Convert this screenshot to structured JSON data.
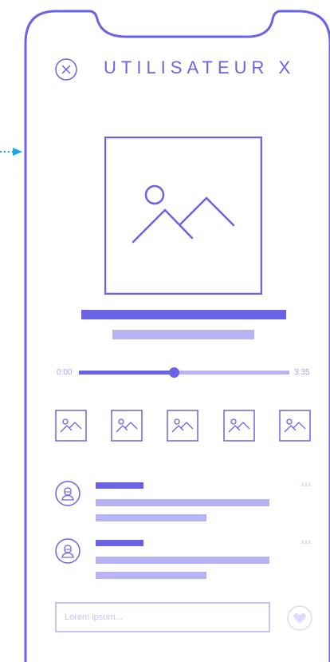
{
  "header": {
    "title": "UTILISATEUR X"
  },
  "player": {
    "time_start": "0:00",
    "time_end": "3:35",
    "progress": 0.45
  },
  "thumbnails": [
    {
      "icon": "image-icon"
    },
    {
      "icon": "image-icon"
    },
    {
      "icon": "image-icon"
    },
    {
      "icon": "image-icon"
    },
    {
      "icon": "image-icon"
    }
  ],
  "comments": [
    {
      "meta": "xxx"
    },
    {
      "meta": "xxx"
    }
  ],
  "composer": {
    "placeholder": "Lorem ipsum..."
  },
  "colors": {
    "primary": "#6a63e6",
    "light": "#b7b3f4",
    "accent": "#18a9e8"
  }
}
